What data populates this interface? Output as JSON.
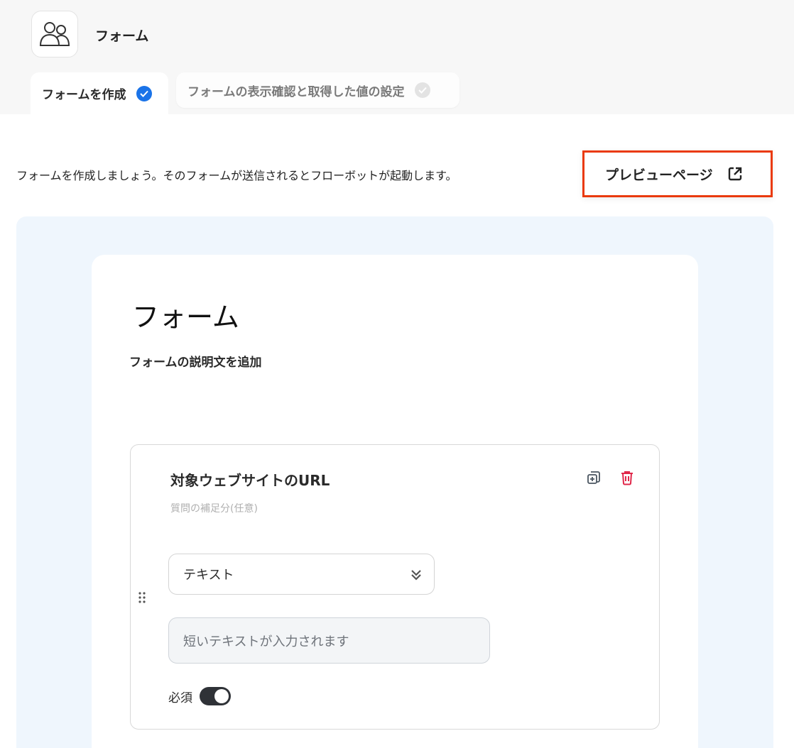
{
  "app": {
    "title": "フォーム",
    "icon": "users-icon"
  },
  "tabs": [
    {
      "label": "フォームを作成",
      "status": "completed",
      "active": true
    },
    {
      "label": "フォームの表示確認と取得した値の設定",
      "status": "pending",
      "active": false
    }
  ],
  "intro_text": "フォームを作成しましょう。そのフォームが送信されるとフローボットが起動します。",
  "preview_button": {
    "label": "プレビューページ",
    "icon": "external-link-icon"
  },
  "form": {
    "title": "フォーム",
    "description_placeholder": "フォームの説明文を追加",
    "questions": [
      {
        "title": "対象ウェブサイトのURL",
        "note_placeholder": "質問の補足分(任意)",
        "type": "テキスト",
        "answer_placeholder": "短いテキストが入力されます",
        "required_label": "必須",
        "required": true
      }
    ]
  },
  "colors": {
    "accent": "#1a73e8",
    "highlight_border": "#ea3a0c",
    "delete": "#e0284a",
    "canvas_bg": "#eff6fd",
    "toggle_on": "#2f3237"
  }
}
